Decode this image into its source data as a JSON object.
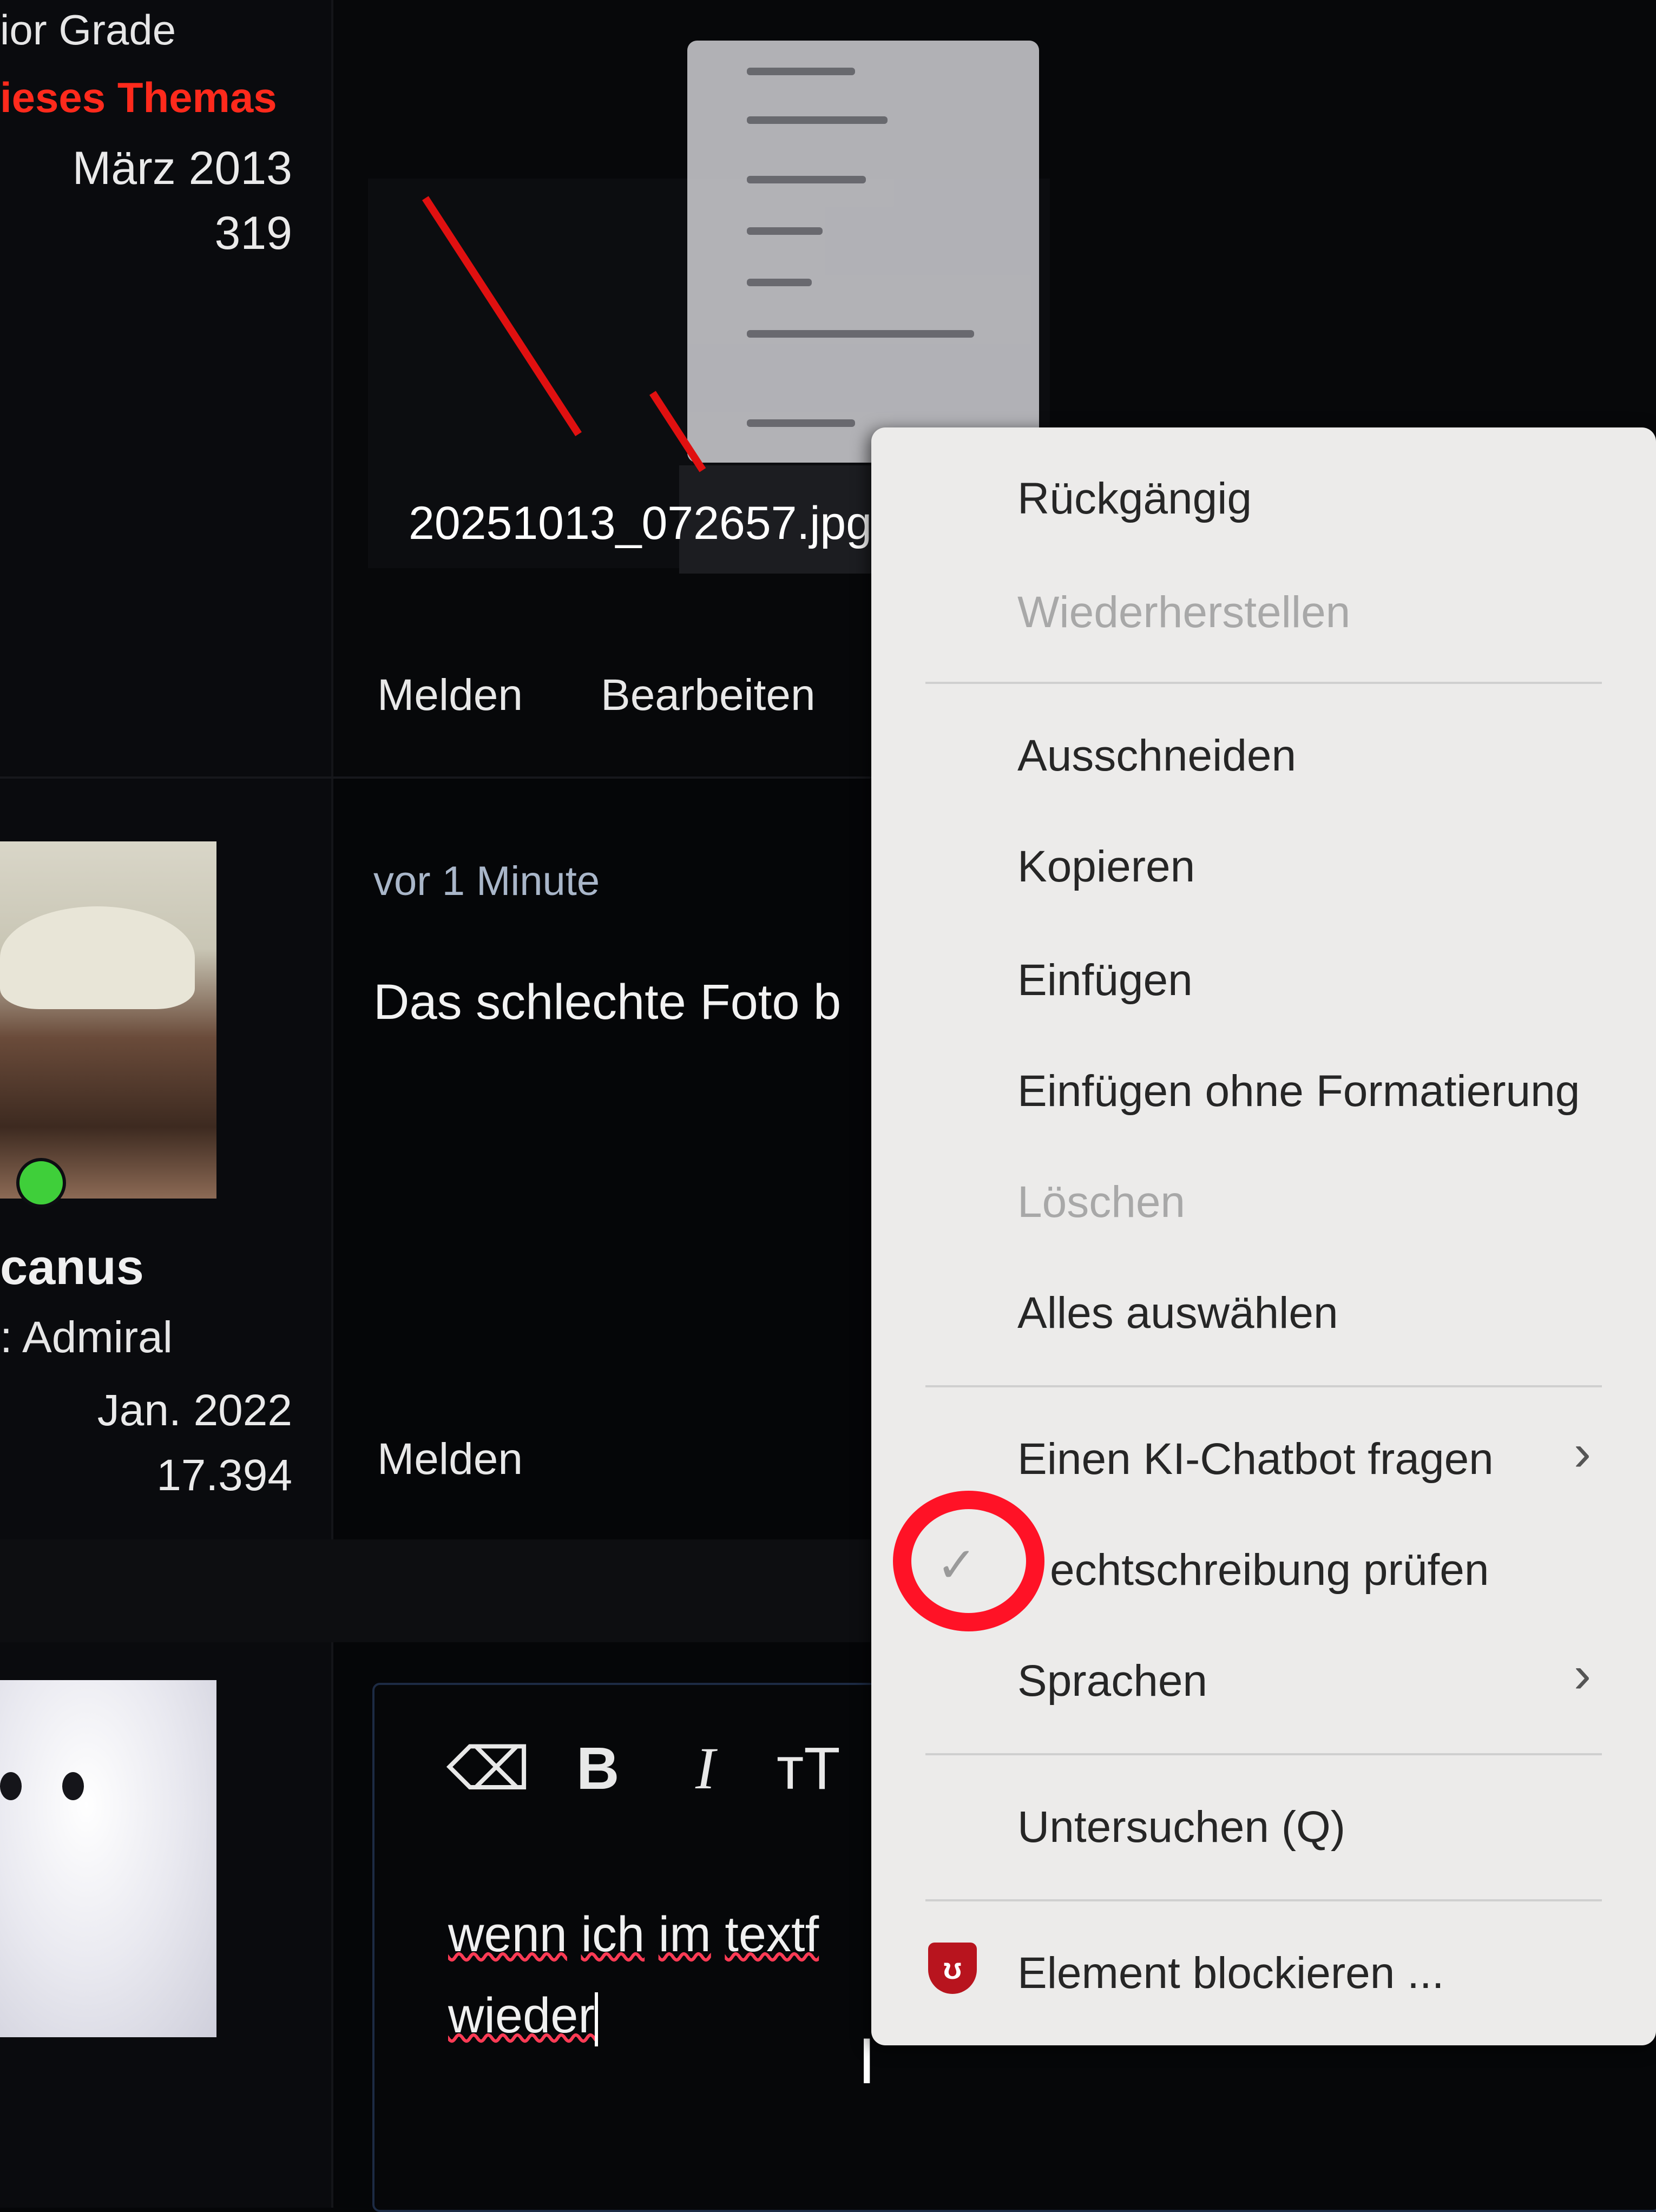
{
  "profile_top": {
    "rank": "ior Grade",
    "thread_starter": "ieses Themas",
    "joined": "März 2013",
    "posts": "319"
  },
  "attachment": {
    "filename": "20251013_072657.jpg"
  },
  "post1_actions": {
    "report": "Melden",
    "edit": "Bearbeiten"
  },
  "post2": {
    "time": "vor 1 Minute",
    "text": "Das schlechte Foto b",
    "report": "Melden",
    "user": {
      "name": "canus",
      "role": ": Admiral",
      "joined": "Jan. 2022",
      "posts": "17.394"
    }
  },
  "editor": {
    "tools": {
      "clear_format": "⌫",
      "bold": "B",
      "italic": "I",
      "text_size": "тT"
    },
    "line1_words": [
      "wenn",
      "ich",
      "im",
      "textf"
    ],
    "line2_word": "wieder"
  },
  "context_menu": {
    "undo": "Rückgängig",
    "redo": "Wiederherstellen",
    "cut": "Ausschneiden",
    "copy": "Kopieren",
    "paste": "Einfügen",
    "paste_plain": "Einfügen ohne Formatierung",
    "delete": "Löschen",
    "select_all": "Alles auswählen",
    "ask_chatbot": "Einen KI-Chatbot fragen",
    "spellcheck": "echtschreibung prüfen",
    "languages": "Sprachen",
    "inspect": "Untersuchen (Q)",
    "block_element": "Element blockieren ..."
  },
  "icons": {
    "submenu": "chevron-right-icon",
    "check": "checkmark-icon",
    "ublock": "ublock-origin-icon"
  },
  "colors": {
    "thread_starter": "#ff2a1c",
    "menu_bg": "#ecebea",
    "annotation": "#ff1226",
    "online": "#3fcf3a"
  }
}
